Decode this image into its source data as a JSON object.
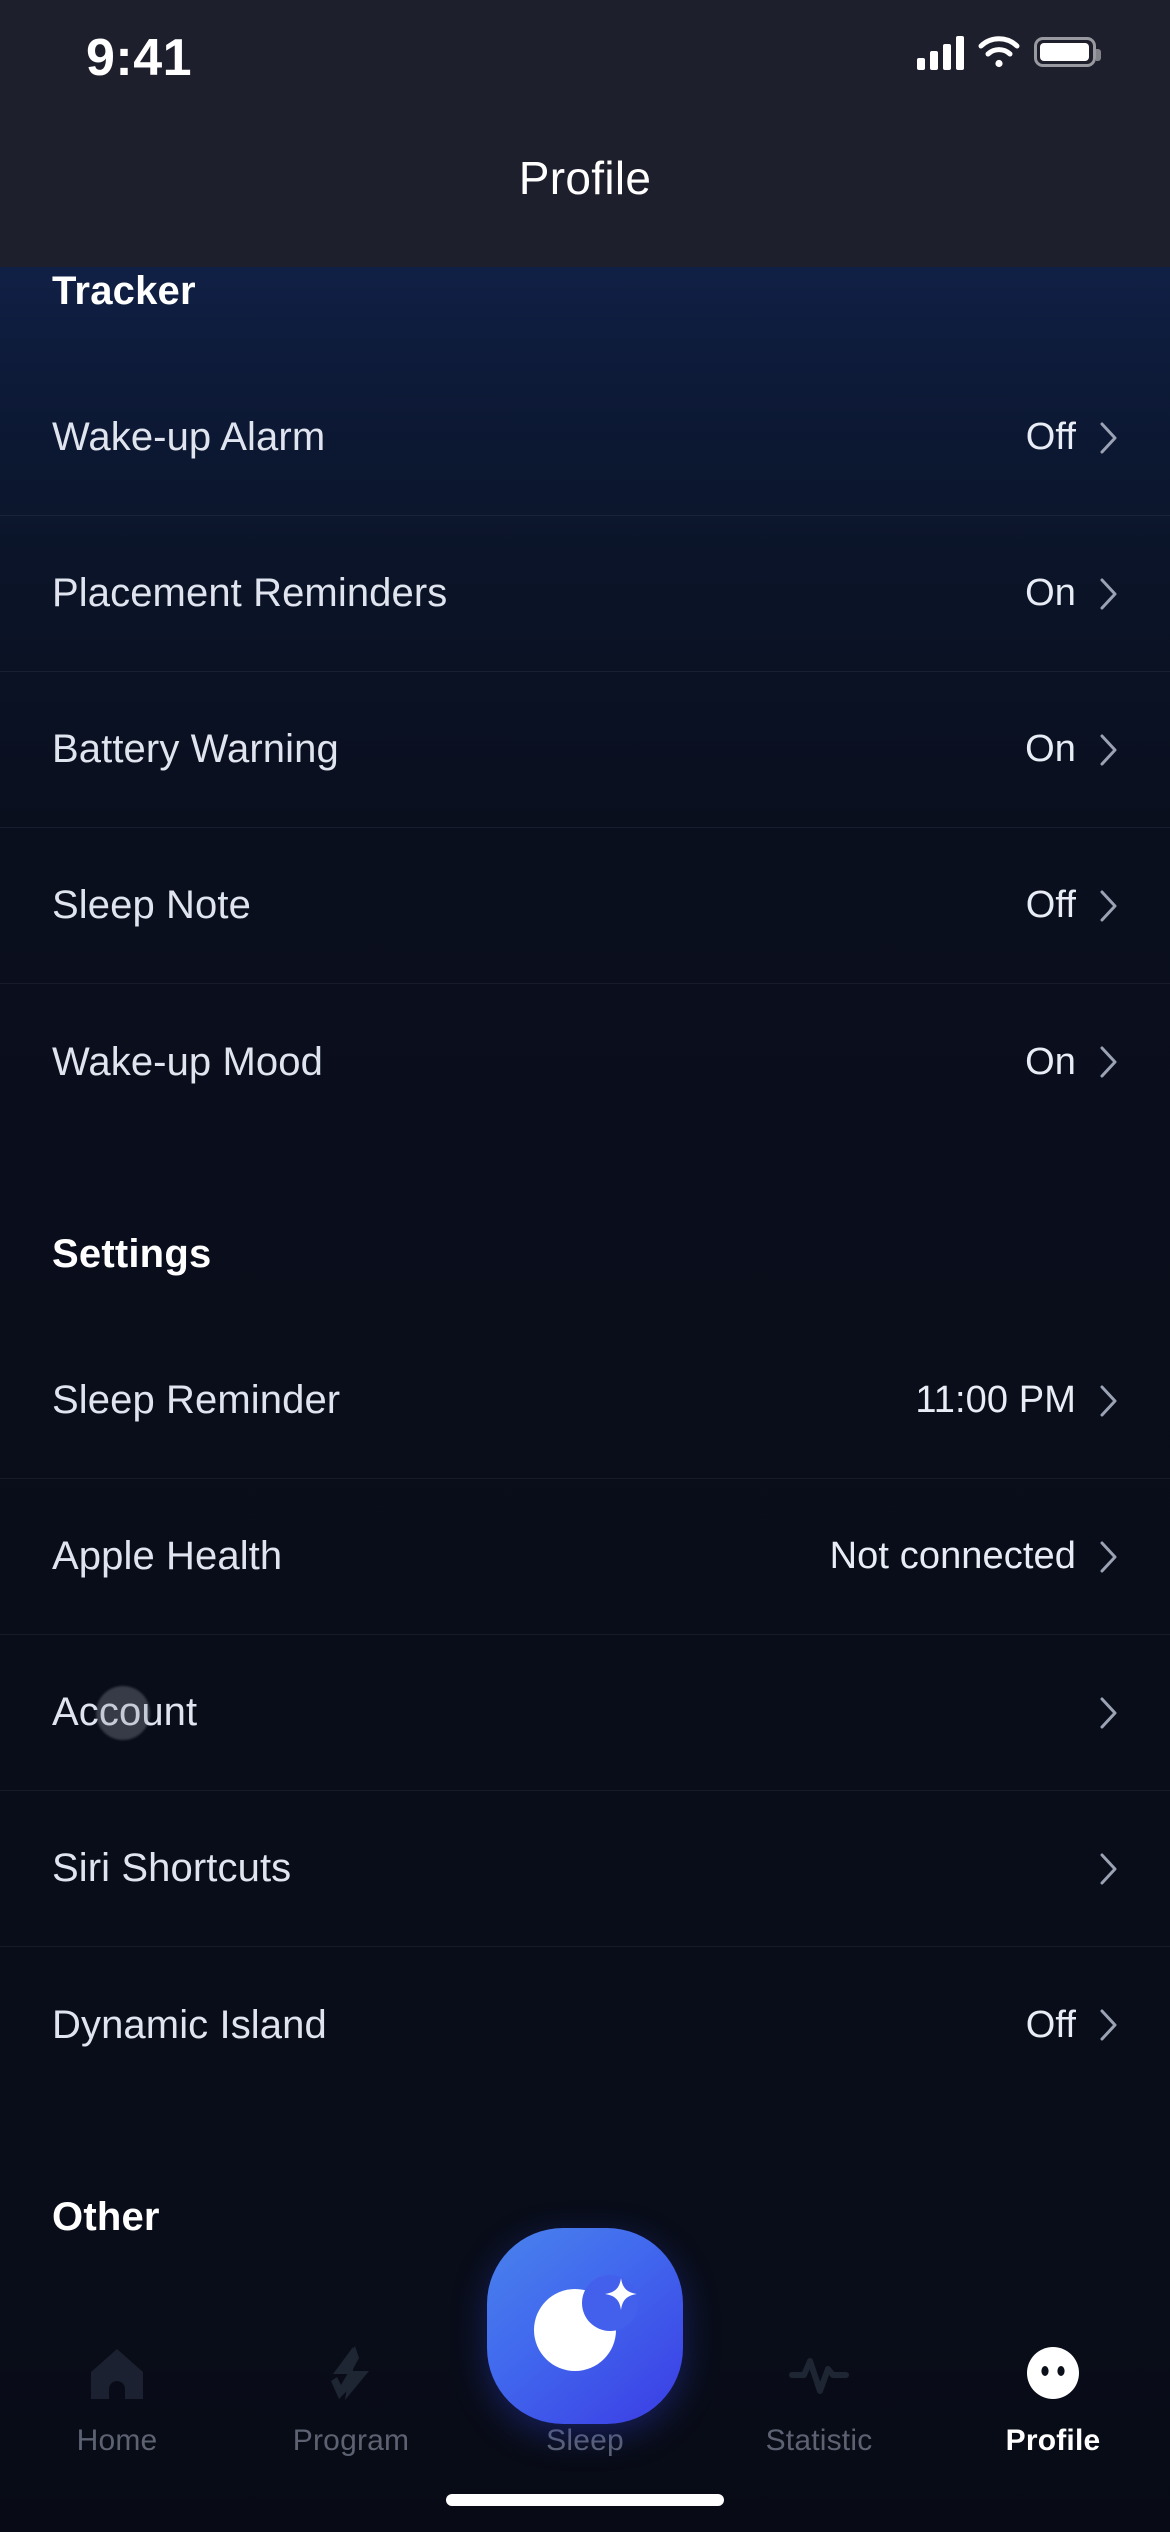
{
  "status_bar": {
    "time": "9:41",
    "cellular_icon": "signal-bars-icon",
    "wifi_icon": "wifi-icon",
    "battery_icon": "battery-icon"
  },
  "header": {
    "title": "Profile"
  },
  "sections": [
    {
      "title": "Tracker",
      "rows": [
        {
          "label": "Wake-up Alarm",
          "value": "Off"
        },
        {
          "label": "Placement Reminders",
          "value": "On"
        },
        {
          "label": "Battery Warning",
          "value": "On"
        },
        {
          "label": "Sleep Note",
          "value": "Off"
        },
        {
          "label": "Wake-up Mood",
          "value": "On"
        }
      ]
    },
    {
      "title": "Settings",
      "rows": [
        {
          "label": "Sleep Reminder",
          "value": "11:00 PM"
        },
        {
          "label": "Apple Health",
          "value": "Not connected"
        },
        {
          "label": "Account",
          "value": ""
        },
        {
          "label": "Siri Shortcuts",
          "value": ""
        },
        {
          "label": "Dynamic Island",
          "value": "Off"
        }
      ]
    },
    {
      "title": "Other",
      "rows": []
    }
  ],
  "tab_bar": {
    "items": [
      {
        "label": "Home",
        "icon": "house-icon",
        "active": false
      },
      {
        "label": "Program",
        "icon": "lightning-bolt-icon",
        "active": false
      },
      {
        "label": "Sleep",
        "icon": "crescent-moon-sparkle-icon",
        "active": false
      },
      {
        "label": "Statistic",
        "icon": "pulse-line-icon",
        "active": false
      },
      {
        "label": "Profile",
        "icon": "face-circle-icon",
        "active": true
      }
    ]
  },
  "colors": {
    "background": "#090d19",
    "header_background": "#1e1f2c",
    "accent_blue": "#4169ee",
    "text_primary": "#ffffff",
    "text_secondary": "#dfe4ef",
    "tab_inactive": "#5c6272"
  }
}
